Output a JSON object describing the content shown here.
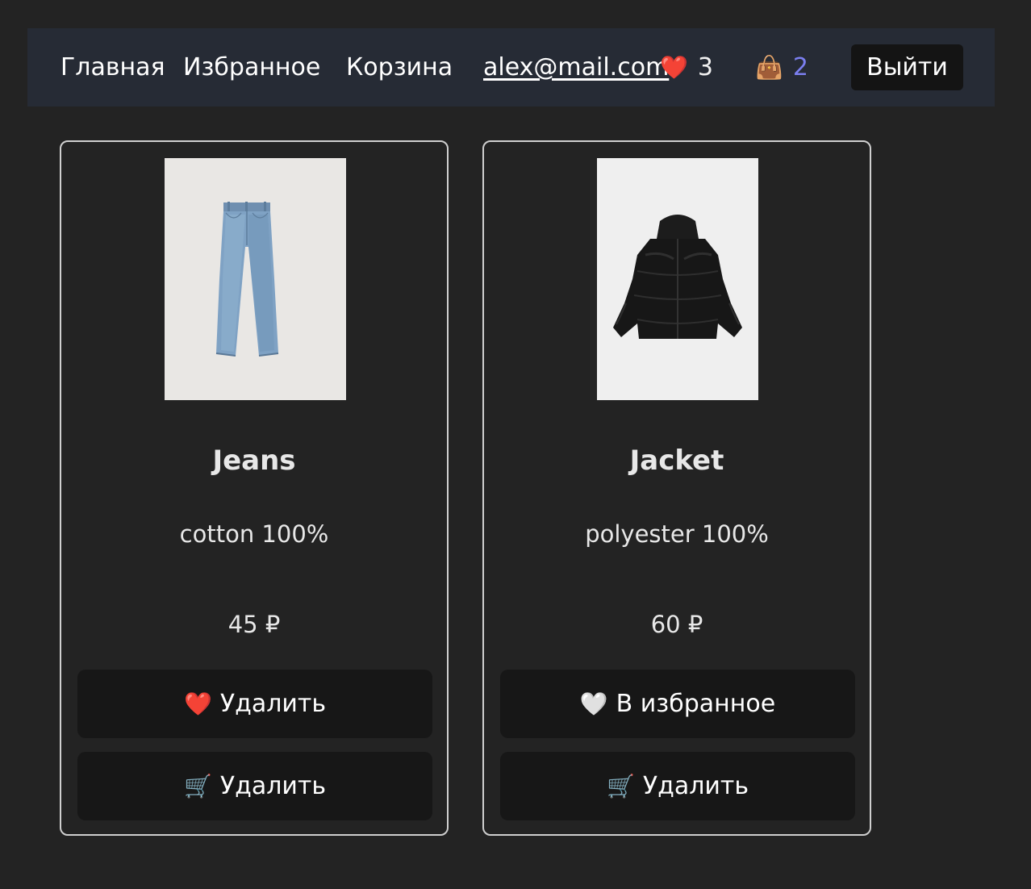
{
  "nav": {
    "home": "Главная",
    "favorites": "Избранное",
    "cart": "Корзина",
    "email": "alex@mail.com",
    "favorites_icon": "❤️",
    "favorites_count": "3",
    "cart_icon": "👜",
    "cart_count": "2",
    "logout": "Выйти"
  },
  "products": [
    {
      "title": "Jeans",
      "description": "cotton 100%",
      "price": "45 ₽",
      "image": "jeans-photo",
      "favorite_icon": "❤️",
      "favorite_label": "Удалить",
      "cart_icon": "🛒",
      "cart_label": "Удалить"
    },
    {
      "title": "Jacket",
      "description": "polyester 100%",
      "price": "60 ₽",
      "image": "jacket-photo",
      "favorite_icon": "🤍",
      "favorite_label": "В избранное",
      "cart_icon": "🛒",
      "cart_label": "Удалить"
    }
  ],
  "colors": {
    "page_bg": "#232323",
    "navbar_bg": "#262b35",
    "button_bg": "#171717",
    "cart_count": "#7b7ff0",
    "card_border": "#cfcfcf"
  }
}
